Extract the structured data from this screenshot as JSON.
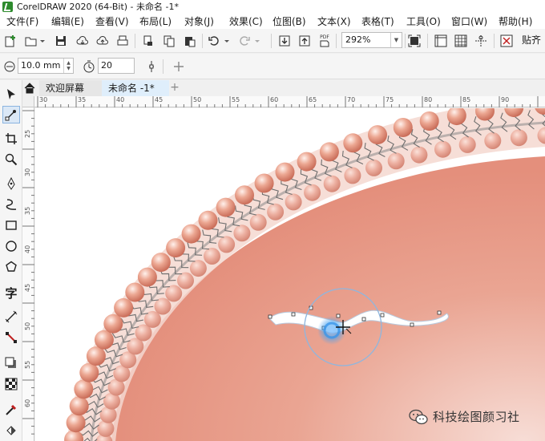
{
  "window": {
    "title": "CorelDRAW 2020 (64-Bit) - 未命名 -1*"
  },
  "menu": [
    "文件(F)",
    "编辑(E)",
    "查看(V)",
    "布局(L)",
    "对象(J)",
    "效果(C)",
    "位图(B)",
    "文本(X)",
    "表格(T)",
    "工具(O)",
    "窗口(W)",
    "帮助(H)"
  ],
  "toolbar": {
    "zoom": "292%",
    "snap_label": "贴齐",
    "pdf_label": "PDF"
  },
  "propbar": {
    "nudge_value": "10.0 mm",
    "smoothing_value": "20"
  },
  "tabs": {
    "welcome": "欢迎屏幕",
    "document": "未命名 -1*"
  },
  "toolbox": {
    "text_tool": "字"
  },
  "ruler": {
    "h_labels": [
      "30",
      "35",
      "40",
      "45",
      "50",
      "55",
      "60",
      "65",
      "70",
      "75",
      "80",
      "85",
      "90"
    ],
    "v_labels": [
      "25",
      "30",
      "35",
      "40",
      "45",
      "50",
      "55",
      "60",
      "65",
      "70"
    ]
  },
  "watermark": {
    "text": "科技绘图颜习社"
  },
  "colors": {
    "accent": "#2e8b2e",
    "membrane_head": "#e89a86",
    "membrane_inner": "#f1c1b2",
    "selection": "#6aa9e8"
  }
}
